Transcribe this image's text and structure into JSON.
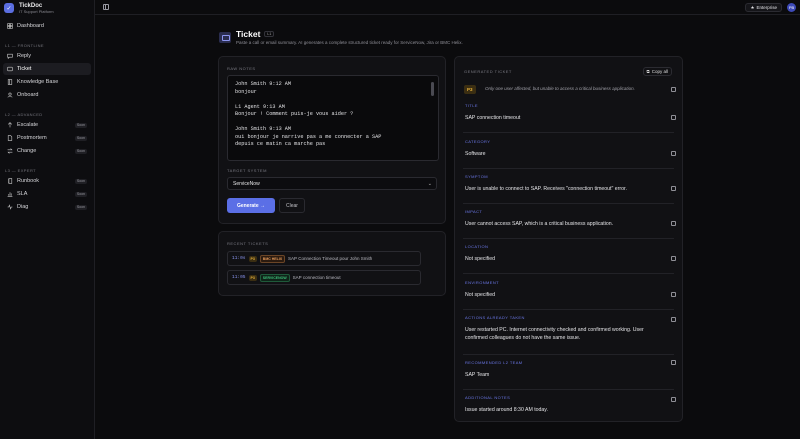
{
  "app": {
    "name": "TickDoc",
    "subtitle": "IT Support Platform",
    "plan": "Enterprise",
    "avatar": "PB"
  },
  "sidebar": {
    "dashboard": "Dashboard",
    "sections": [
      {
        "label": "L1 — FRONTLINE",
        "items": [
          {
            "label": "Reply"
          },
          {
            "label": "Ticket"
          },
          {
            "label": "Knowledge Base"
          },
          {
            "label": "Onboard"
          }
        ]
      },
      {
        "label": "L2 — ADVANCED",
        "items": [
          {
            "label": "Escalate",
            "badge": "Soon"
          },
          {
            "label": "Postmortem",
            "badge": "Soon"
          },
          {
            "label": "Change",
            "badge": "Soon"
          }
        ]
      },
      {
        "label": "L3 — EXPERT",
        "items": [
          {
            "label": "Runbook",
            "badge": "Soon"
          },
          {
            "label": "SLA",
            "badge": "Soon"
          },
          {
            "label": "Diag",
            "badge": "Soon"
          }
        ]
      }
    ]
  },
  "header": {
    "title": "Ticket",
    "kbd": "L1",
    "subtitle": "Paste a call or email summary. AI generates a complete structured ticket ready for ServiceNow, Jira or BMC Helix."
  },
  "raw": {
    "label": "RAW NOTES",
    "notes": "John Smith 9:12 AM\nbonjour\n\nL1 Agent 9:13 AM\nBonjour ! Comment puis-je vous aider ?\n\nJohn Smith 9:13 AM\noui bonjour je narrive pas a me connecter a SAP\ndepuis ce matin ca marche pas",
    "target_label": "TARGET SYSTEM",
    "target_value": "ServiceNow",
    "generate": "Generate →",
    "clear": "Clear"
  },
  "recent": {
    "label": "RECENT TICKETS",
    "items": [
      {
        "time": "11:0s",
        "priority": "P3",
        "system": "BMC HELIX",
        "title": "SAP Connection Timeout pour John Smith",
        "color": "#e59b5b"
      },
      {
        "time": "11:05",
        "priority": "P3",
        "system": "SERVICENOW",
        "title": "SAP connection timeout",
        "color": "#3fbf7a"
      }
    ]
  },
  "generated": {
    "label": "GENERATED TICKET",
    "copy_all": "Copy all",
    "priority": "P3",
    "priority_note": "Only one user affected, but unable to access a critical business application.",
    "fields": [
      {
        "label": "TITLE",
        "value": "SAP connection timeout"
      },
      {
        "label": "CATEGORY",
        "value": "Software"
      },
      {
        "label": "SYMPTOM",
        "value": "User is unable to connect to SAP. Receives \"connection timeout\" error."
      },
      {
        "label": "IMPACT",
        "value": "User cannot access SAP, which is a critical business application."
      },
      {
        "label": "LOCATION",
        "value": "Not specified"
      },
      {
        "label": "ENVIRONMENT",
        "value": "Not specified"
      },
      {
        "label": "ACTIONS ALREADY TAKEN",
        "value": "User restarted PC. Internet connectivity checked and confirmed working. User confirmed colleagues do not have the same issue."
      },
      {
        "label": "RECOMMENDED L2 TEAM",
        "value": "SAP Team"
      },
      {
        "label": "ADDITIONAL NOTES",
        "value": "Issue started around 8:30 AM today."
      }
    ]
  }
}
